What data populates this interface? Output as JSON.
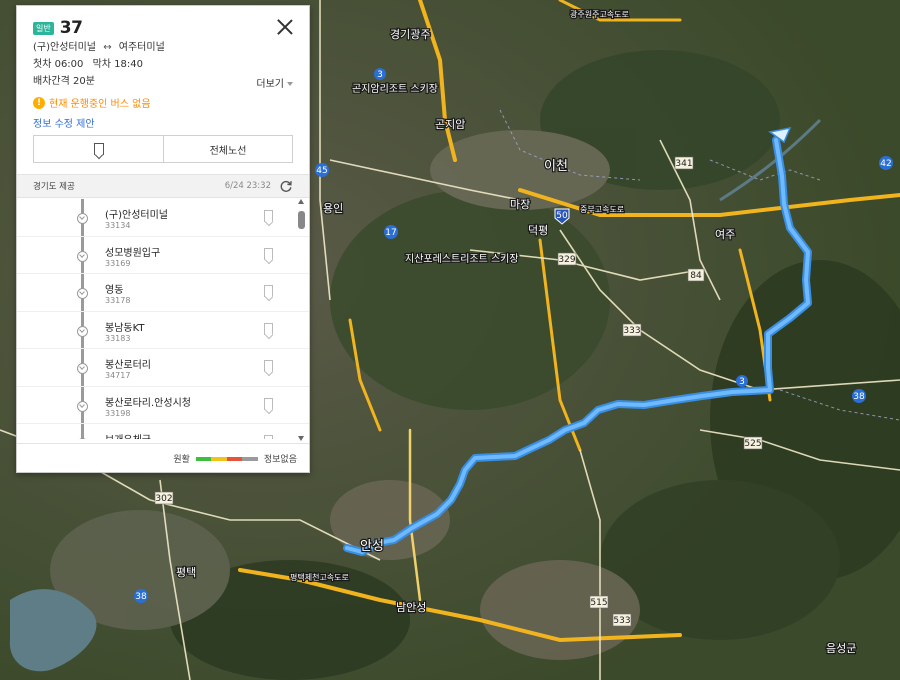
{
  "panel": {
    "badge": "일반",
    "route_number": "37",
    "origin": "(구)안성터미널",
    "arrow": "↔",
    "destination": "여주터미널",
    "first_label": "첫차 06:00",
    "last_label": "막차 18:40",
    "interval": "배차간격 20분",
    "more": "더보기",
    "warning": "현재 운행중인 버스 없음",
    "suggest": "정보 수정 제안",
    "full_route": "전체노선",
    "provider": "경기도 제공",
    "updated": "6/24 23:32"
  },
  "stops": [
    {
      "name": "(구)안성터미널",
      "id": "33134"
    },
    {
      "name": "성모병원입구",
      "id": "33169"
    },
    {
      "name": "영동",
      "id": "33178"
    },
    {
      "name": "봉남동KT",
      "id": "33183"
    },
    {
      "name": "봉산로터리",
      "id": "34717"
    },
    {
      "name": "봉산로타리.안성시청",
      "id": "33198"
    },
    {
      "name": "보개우체국",
      "id": ""
    }
  ],
  "legend": {
    "smooth": "원활",
    "no_info": "정보없음",
    "colors": [
      "#3cbf3c",
      "#f2c21b",
      "#e5533b",
      "#9a9a9a"
    ]
  },
  "map": {
    "route_color": "#6fb9ff",
    "labels": [
      "경기광주",
      "곤지암리조트 스키장",
      "곤지암",
      "이천",
      "마장",
      "덕평",
      "지산포레스트리조트 스키장",
      "용인",
      "여주",
      "안성",
      "평택",
      "남안성",
      "음성군",
      "광주원주고속도로",
      "중부고속도로",
      "평택제천고속도로"
    ],
    "shields": [
      "3",
      "50",
      "17",
      "329",
      "333",
      "341",
      "42",
      "84",
      "3",
      "38",
      "525",
      "515",
      "533",
      "302",
      "38",
      "45"
    ]
  }
}
